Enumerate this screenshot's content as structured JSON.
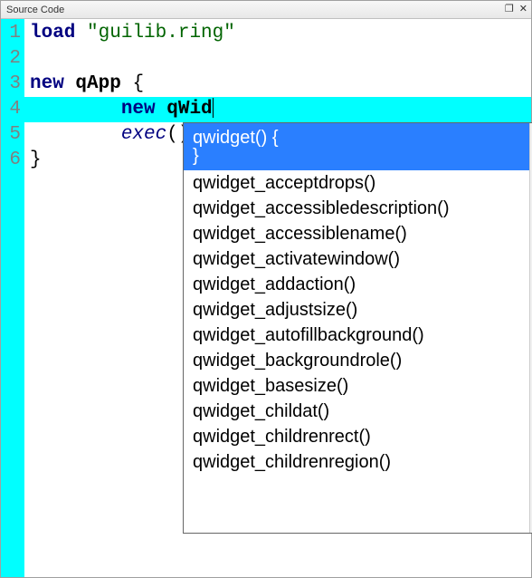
{
  "titlebar": {
    "title": "Source Code"
  },
  "gutter": {
    "lines": [
      "1",
      "2",
      "3",
      "4",
      "5",
      "6"
    ]
  },
  "code": {
    "lines": [
      {
        "kw": "load",
        "sp1": " ",
        "str": "\"guilib.ring\""
      },
      {},
      {
        "kw": "new",
        "sp1": " ",
        "ident": "qApp",
        "sp2": " ",
        "plain": "{"
      },
      {
        "indent": "        ",
        "kw": "new",
        "sp1": " ",
        "ident": "qWid"
      },
      {
        "indent": "        ",
        "func": "exec",
        "plain": "()"
      },
      {
        "plain": "}"
      }
    ],
    "active_line_index": 3
  },
  "autocomplete": {
    "selected_index": 0,
    "items": [
      "qwidget() {\n}",
      "qwidget_acceptdrops()",
      "qwidget_accessibledescription()",
      "qwidget_accessiblename()",
      "qwidget_activatewindow()",
      "qwidget_addaction()",
      "qwidget_adjustsize()",
      "qwidget_autofillbackground()",
      "qwidget_backgroundrole()",
      "qwidget_basesize()",
      "qwidget_childat()",
      "qwidget_childrenrect()",
      "qwidget_childrenregion()"
    ]
  }
}
